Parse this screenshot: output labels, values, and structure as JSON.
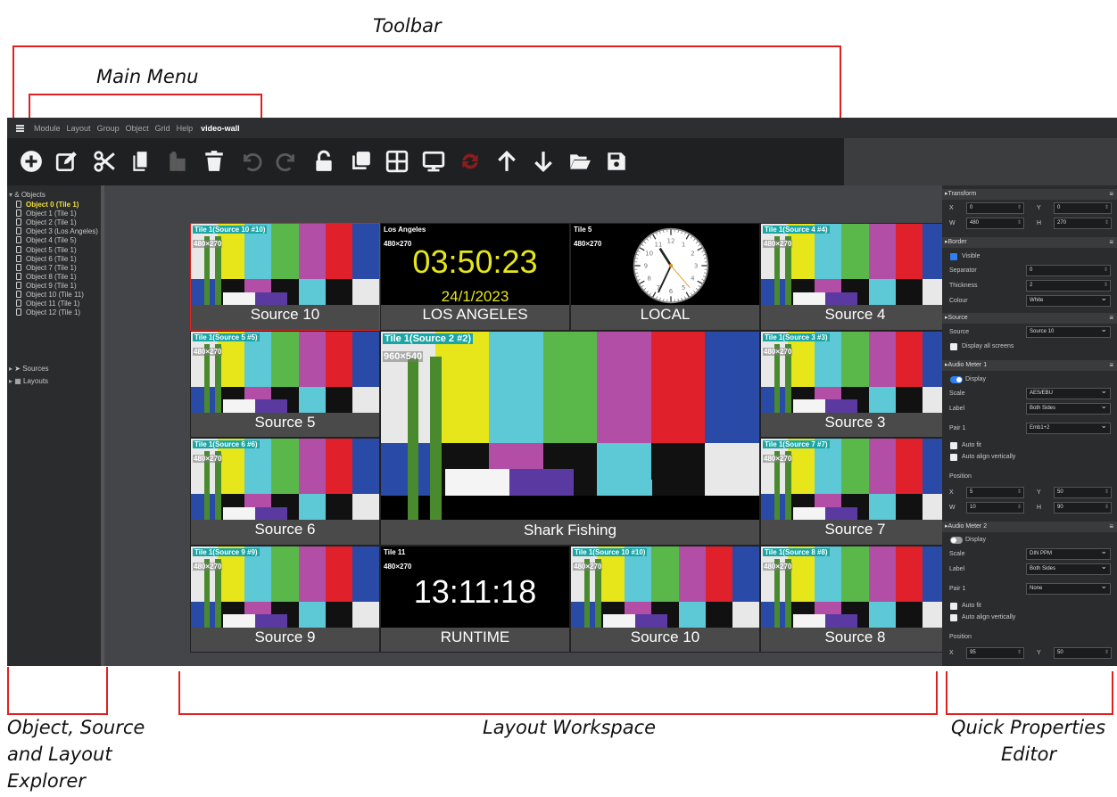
{
  "callouts": {
    "toolbar": "Toolbar",
    "main_menu": "Main Menu",
    "explorer_line1": "Object, Source",
    "explorer_line2": "and Layout",
    "explorer_line3": "Explorer",
    "workspace": "Layout Workspace",
    "props_line1": "Quick Properties",
    "props_line2": "Editor"
  },
  "menu": {
    "items": [
      "Module",
      "Layout",
      "Group",
      "Object",
      "Grid",
      "Help"
    ],
    "brand": "video-wall"
  },
  "toolbar": {
    "icons": [
      "add-icon",
      "edit-icon",
      "cut-icon",
      "copy-icon",
      "paste-icon",
      "delete-icon",
      "undo-icon",
      "redo-icon",
      "unlock-icon",
      "duplicate-icon",
      "grid-icon",
      "monitor-icon",
      "refresh-icon",
      "move-up-icon",
      "move-down-icon",
      "open-folder-icon",
      "save-icon"
    ],
    "disabled": [
      false,
      false,
      false,
      false,
      true,
      false,
      true,
      true,
      false,
      false,
      false,
      false,
      true,
      false,
      false,
      false,
      false
    ]
  },
  "explorer": {
    "objects_label": "Objects",
    "objects": [
      "Object 0 (Tile 1)",
      "Object 1 (Tile 1)",
      "Object 2 (Tile 1)",
      "Object 3 (Los Angeles)",
      "Object 4 (Tile 5)",
      "Object 5 (Tile 1)",
      "Object 6 (Tile 1)",
      "Object 7 (Tile 1)",
      "Object 8 (Tile 1)",
      "Object 9 (Tile 1)",
      "Object 10 (Tile 11)",
      "Object 11 (Tile 1)",
      "Object 12 (Tile 1)"
    ],
    "selected_index": 0,
    "sources_label": "Sources",
    "layouts_label": "Layouts"
  },
  "tiles": [
    {
      "kind": "bars",
      "tag": "Tile 1(Source 10 #10)",
      "res": "480×270",
      "label": "Source 10",
      "col": 0,
      "row": 0,
      "cs": 1,
      "rs": 1,
      "selected": true
    },
    {
      "kind": "clock",
      "title": "Los Angeles",
      "res": "480×270",
      "time": "03:50:23",
      "date": "24/1/2023",
      "label": "LOS ANGELES",
      "col": 1,
      "row": 0,
      "cs": 1,
      "rs": 1
    },
    {
      "kind": "analog",
      "title": "Tile 5",
      "res": "480×270",
      "label": "LOCAL",
      "col": 2,
      "row": 0,
      "cs": 1,
      "rs": 1
    },
    {
      "kind": "bars",
      "tag": "Tile 1(Source 4 #4)",
      "res": "480×270",
      "label": "Source 4",
      "col": 3,
      "row": 0,
      "cs": 1,
      "rs": 1
    },
    {
      "kind": "bars",
      "tag": "Tile 1(Source 5 #5)",
      "res": "480×270",
      "label": "Source 5",
      "col": 0,
      "row": 1,
      "cs": 1,
      "rs": 1
    },
    {
      "kind": "bars",
      "tag": "Tile 1(Source 2 #2)",
      "res": "960×540",
      "label": "Shark Fishing",
      "col": 1,
      "row": 1,
      "cs": 2,
      "rs": 2
    },
    {
      "kind": "bars",
      "tag": "Tile 1(Source 3 #3)",
      "res": "480×270",
      "label": "Source 3",
      "col": 3,
      "row": 1,
      "cs": 1,
      "rs": 1
    },
    {
      "kind": "bars",
      "tag": "Tile 1(Source 6 #6)",
      "res": "480×270",
      "label": "Source 6",
      "col": 0,
      "row": 2,
      "cs": 1,
      "rs": 1
    },
    {
      "kind": "bars",
      "tag": "Tile 1(Source 7 #7)",
      "res": "480×270",
      "label": "Source 7",
      "col": 3,
      "row": 2,
      "cs": 1,
      "rs": 1
    },
    {
      "kind": "bars",
      "tag": "Tile 1(Source 9 #9)",
      "res": "480×270",
      "label": "Source 9",
      "col": 0,
      "row": 3,
      "cs": 1,
      "rs": 1
    },
    {
      "kind": "clock",
      "title": "Tile 11",
      "res": "480×270",
      "time": "13:11:18",
      "date": "",
      "label": "RUNTIME",
      "col": 1,
      "row": 3,
      "cs": 1,
      "rs": 1
    },
    {
      "kind": "bars",
      "tag": "Tile 1(Source 10 #10)",
      "res": "480×270",
      "label": "Source 10",
      "col": 2,
      "row": 3,
      "cs": 1,
      "rs": 1
    },
    {
      "kind": "bars",
      "tag": "Tile 1(Source 8 #8)",
      "res": "480×270",
      "label": "Source 8",
      "col": 3,
      "row": 3,
      "cs": 1,
      "rs": 1
    }
  ],
  "colors": {
    "bars": [
      "#e8e8e8",
      "#e6e61a",
      "#5dc8d6",
      "#5ab84a",
      "#b24ea5",
      "#e0202a",
      "#2a4aa8"
    ],
    "lower": [
      "#2a4aa8",
      "#111",
      "#b24ea5",
      "#111",
      "#5dc8d6",
      "#111",
      "#e8e8e8"
    ],
    "accent": "#e02020",
    "clock_text": "#e6e61a"
  },
  "props": {
    "transform": {
      "title": "Transform",
      "x_label": "X",
      "x": "0",
      "y_label": "Y",
      "y": "0",
      "w_label": "W",
      "w": "480",
      "h_label": "H",
      "h": "270"
    },
    "border": {
      "title": "Border",
      "visible": "Visible",
      "separator_label": "Separator",
      "separator": "0",
      "thickness_label": "Thickness",
      "thickness": "2",
      "colour_label": "Colour",
      "colour": "White"
    },
    "source": {
      "title": "Source",
      "source_label": "Source",
      "source": "Source 10",
      "display_all": "Display all screens"
    },
    "meter1": {
      "title": "Audio Meter 1",
      "display": "Display",
      "display_on": true,
      "scale_label": "Scale",
      "scale": "AES/EBU",
      "label_label": "Label",
      "label": "Both Sides",
      "pair_label": "Pair 1",
      "pair": "Emb1+2",
      "auto_fit": "Auto fit",
      "auto_align": "Auto align vertically",
      "position": "Position",
      "x_label": "X",
      "x": "5",
      "y_label": "Y",
      "y": "50",
      "w_label": "W",
      "w": "10",
      "h_label": "H",
      "h": "90"
    },
    "meter2": {
      "title": "Audio Meter 2",
      "display": "Display",
      "display_on": false,
      "scale_label": "Scale",
      "scale": "DIN PPM",
      "label_label": "Label",
      "label": "Both Sides",
      "pair_label": "Pair 1",
      "pair": "None",
      "auto_fit": "Auto fit",
      "auto_align": "Auto align vertically",
      "position": "Position",
      "x_label": "X",
      "x": "95",
      "y_label": "Y",
      "y": "50"
    }
  }
}
